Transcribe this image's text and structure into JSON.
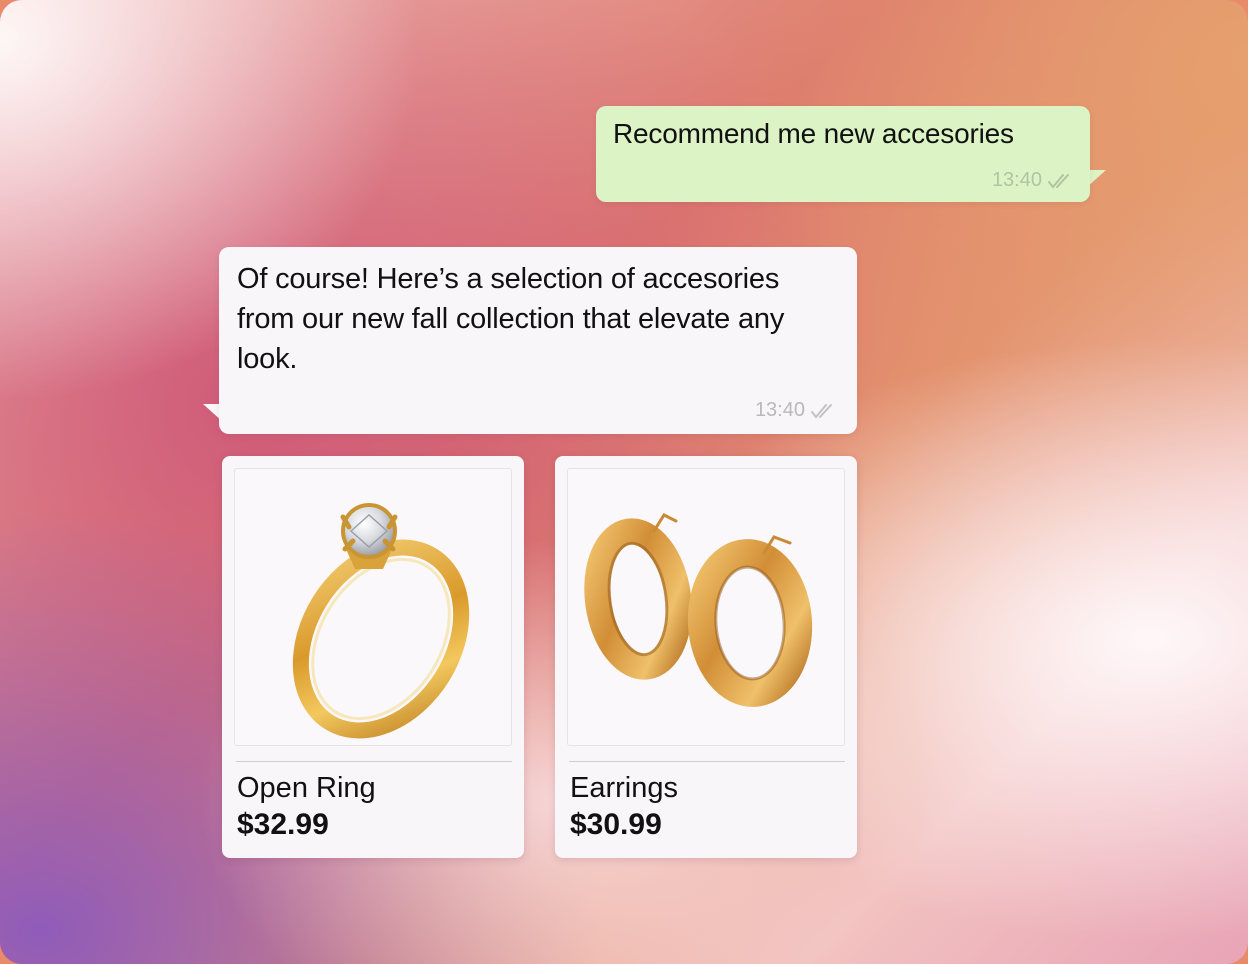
{
  "chat": {
    "user_message": {
      "text": "Recommend me new accesories",
      "time": "13:40"
    },
    "bot_message": {
      "text": "Of course! Here’s a selection of accesories from our new fall collection that elevate any look.",
      "time": "13:40"
    }
  },
  "products": [
    {
      "name": "Open Ring",
      "price": "$32.99",
      "image": "gold-solitaire-ring"
    },
    {
      "name": "Earrings",
      "price": "$30.99",
      "image": "gold-hoop-earrings"
    }
  ],
  "colors": {
    "user_bubble": "#dcf3c5",
    "bot_bubble": "#f8f6f8",
    "gold": "#d9a23a"
  }
}
